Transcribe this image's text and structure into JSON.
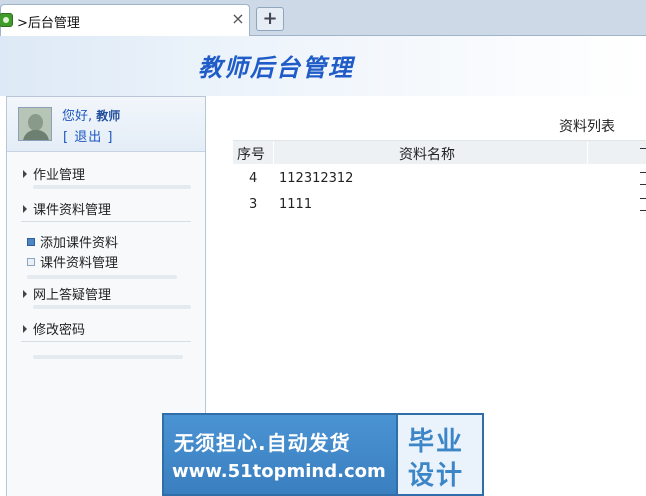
{
  "browser": {
    "tab_title": ">后台管理",
    "close_glyph": "×",
    "new_tab_glyph": "+"
  },
  "header": {
    "brand": "教师后台管理"
  },
  "sidebar": {
    "greeting": "您好,",
    "role": "教师",
    "logout": "[ 退出 ]",
    "menu": [
      {
        "label": "作业管理"
      },
      {
        "label": "课件资料管理",
        "children": [
          {
            "label": "添加课件资料",
            "active": true
          },
          {
            "label": "课件资料管理",
            "active": false
          }
        ]
      },
      {
        "label": "网上答疑管理"
      },
      {
        "label": "修改密码"
      }
    ]
  },
  "main": {
    "list_title": "资料列表",
    "columns": [
      "序号",
      "资料名称"
    ],
    "rows": [
      {
        "index": "4",
        "name": "112312312"
      },
      {
        "index": "3",
        "name": "1111"
      }
    ]
  },
  "watermark": {
    "line1": "无须担心.自动发货",
    "line2": "www.51topmind.com",
    "right1": "毕业",
    "right2": "设计"
  },
  "colors": {
    "brand": "#1f5cc8",
    "watermark": "#3c86c8"
  }
}
